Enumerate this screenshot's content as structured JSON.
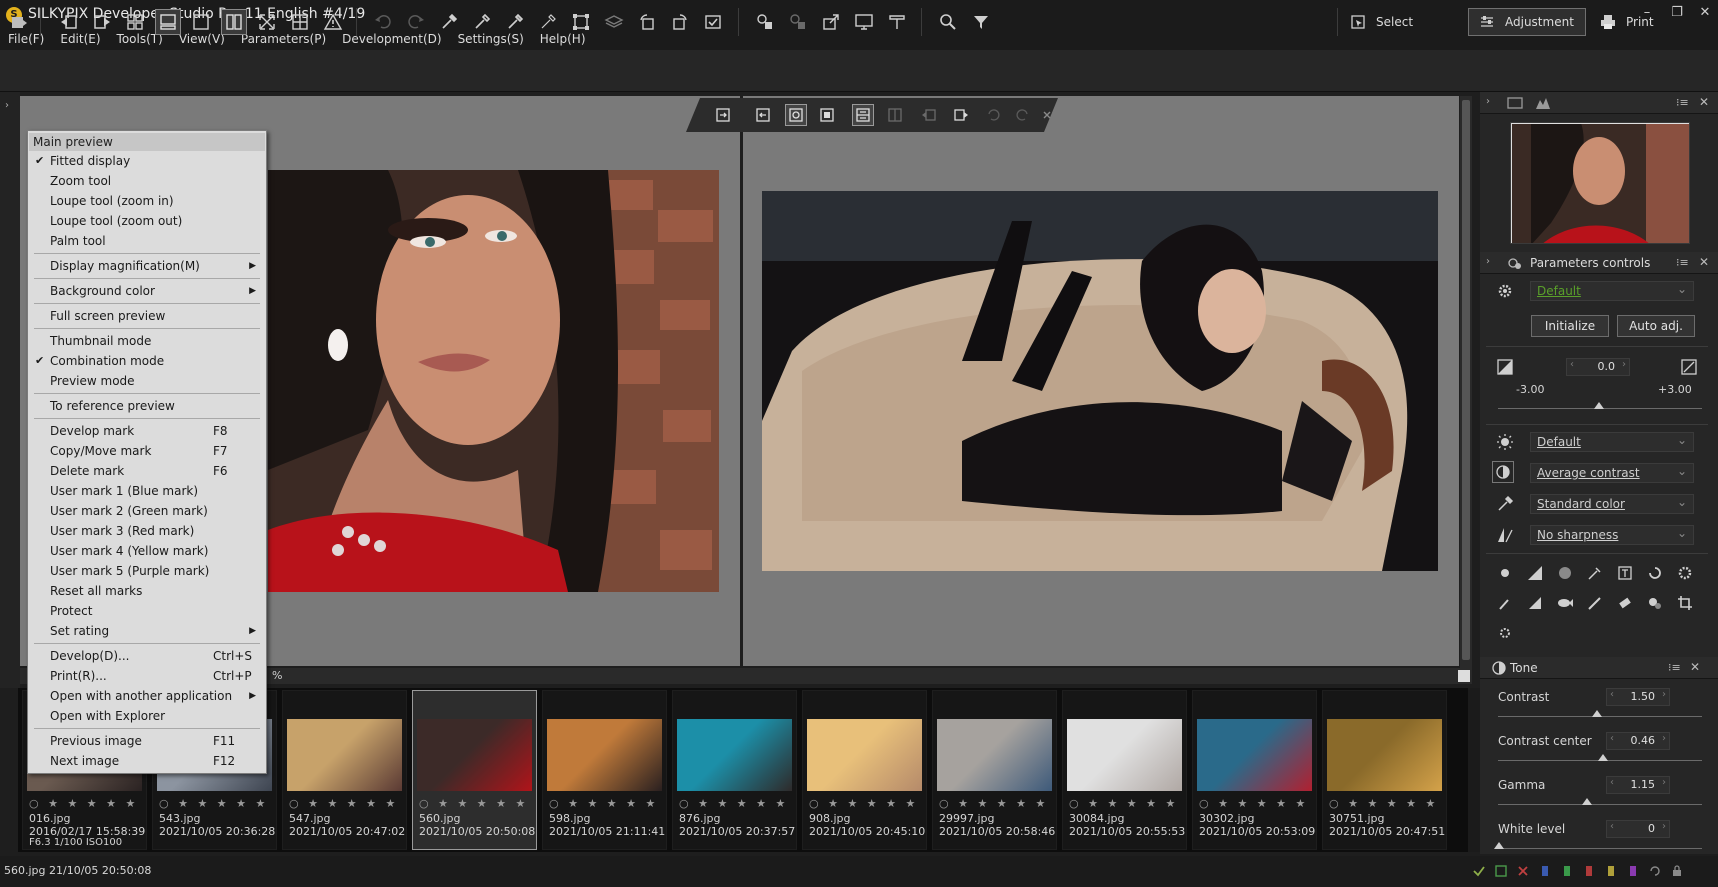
{
  "window": {
    "title": "SILKYPIX Developer Studio Pro 11 English   #4/19",
    "minimize": "–",
    "maximize": "❐",
    "close": "✕"
  },
  "menubar": [
    "File(F)",
    "Edit(E)",
    "Tools(T)",
    "View(V)",
    "Parameters(P)",
    "Development(D)",
    "Settings(S)",
    "Help(H)"
  ],
  "modes": {
    "select": "Select",
    "adjustment": "Adjustment",
    "print": "Print"
  },
  "context_menu": {
    "header": "Main preview",
    "items": [
      {
        "label": "Fitted display",
        "checked": true
      },
      {
        "label": "Zoom tool"
      },
      {
        "label": "Loupe tool (zoom in)"
      },
      {
        "label": "Loupe tool (zoom out)"
      },
      {
        "label": "Palm tool"
      },
      {
        "sep": true
      },
      {
        "label": "Display magnification(M)",
        "submenu": true
      },
      {
        "sep": true
      },
      {
        "label": "Background color",
        "submenu": true
      },
      {
        "sep": true
      },
      {
        "label": "Full screen preview"
      },
      {
        "sep": true
      },
      {
        "label": "Thumbnail mode"
      },
      {
        "label": "Combination mode",
        "checked": true
      },
      {
        "label": "Preview mode"
      },
      {
        "sep": true
      },
      {
        "label": "To reference preview"
      },
      {
        "sep": true
      },
      {
        "label": "Develop mark",
        "shortcut": "F8"
      },
      {
        "label": "Copy/Move mark",
        "shortcut": "F7"
      },
      {
        "label": "Delete mark",
        "shortcut": "F6"
      },
      {
        "label": "User mark 1 (Blue mark)"
      },
      {
        "label": "User mark 2 (Green mark)"
      },
      {
        "label": "User mark 3 (Red mark)"
      },
      {
        "label": "User mark 4 (Yellow mark)"
      },
      {
        "label": "User mark 5 (Purple mark)"
      },
      {
        "label": "Reset all marks"
      },
      {
        "label": "Protect"
      },
      {
        "label": "Set rating",
        "submenu": true
      },
      {
        "sep": true
      },
      {
        "label": "Develop(D)...",
        "shortcut": "Ctrl+S"
      },
      {
        "label": "Print(R)...",
        "shortcut": "Ctrl+P"
      },
      {
        "label": "Open with another application",
        "submenu": true
      },
      {
        "label": "Open with Explorer"
      },
      {
        "sep": true
      },
      {
        "label": "Previous image",
        "shortcut": "F11"
      },
      {
        "label": "Next image",
        "shortcut": "F12"
      }
    ]
  },
  "preview": {
    "zoom_suffix": "%"
  },
  "filmstrip": [
    {
      "name": "016.jpg",
      "date": "2016/02/17 15:58:39",
      "extra": "F6.3 1/100 ISO100",
      "colors": [
        "#6a5a50",
        "#2a2222"
      ]
    },
    {
      "name": "543.jpg",
      "date": "2021/10/05 20:36:28",
      "colors": [
        "#8c94a0",
        "#3d4450"
      ]
    },
    {
      "name": "547.jpg",
      "date": "2021/10/05 20:47:02",
      "colors": [
        "#c7a26a",
        "#5a3a34"
      ]
    },
    {
      "name": "560.jpg",
      "date": "2021/10/05 20:50:08",
      "selected": true,
      "colors": [
        "#3c2a28",
        "#b0141a"
      ]
    },
    {
      "name": "598.jpg",
      "date": "2021/10/05 21:11:41",
      "colors": [
        "#c07a3a",
        "#2a2020"
      ]
    },
    {
      "name": "876.jpg",
      "date": "2021/10/05 20:37:57",
      "colors": [
        "#1c8fa8",
        "#2e2a2a"
      ]
    },
    {
      "name": "908.jpg",
      "date": "2021/10/05 20:45:10",
      "colors": [
        "#e8c07a",
        "#b58a6a"
      ]
    },
    {
      "name": "29997.jpg",
      "date": "2021/10/05 20:58:46",
      "colors": [
        "#a6a29e",
        "#3e5a7a"
      ]
    },
    {
      "name": "30084.jpg",
      "date": "2021/10/05 20:55:53",
      "colors": [
        "#e0e0e0",
        "#b0a8a4"
      ]
    },
    {
      "name": "30302.jpg",
      "date": "2021/10/05 20:53:09",
      "colors": [
        "#2a6a8a",
        "#b12030"
      ]
    },
    {
      "name": "30751.jpg",
      "date": "2021/10/05 20:47:51",
      "colors": [
        "#8a6a2a",
        "#d4a24a"
      ]
    }
  ],
  "rating_stars": "○ ★ ★ ★ ★ ★",
  "statusbar": {
    "text": "560.jpg 21/10/05 20:50:08"
  },
  "right_panel": {
    "parameters_title": "Parameters controls",
    "taste": "Default",
    "initialize": "Initialize",
    "auto_adj": "Auto adj.",
    "exposure": {
      "value": "0.0",
      "min": "-3.00",
      "max": "+3.00"
    },
    "white_balance": "Default",
    "contrast_preset": "Average contrast",
    "color_preset": "Standard color",
    "sharpness_preset": "No sharpness",
    "tone_title": "Tone",
    "tone": [
      {
        "label": "Contrast",
        "value": "1.50"
      },
      {
        "label": "Contrast center",
        "value": "0.46"
      },
      {
        "label": "Gamma",
        "value": "1.15"
      },
      {
        "label": "White level",
        "value": "0"
      }
    ]
  }
}
